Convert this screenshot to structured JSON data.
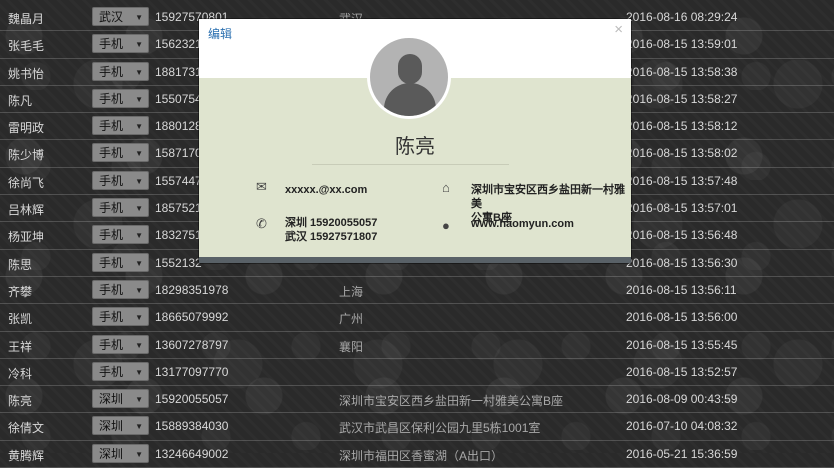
{
  "table": {
    "rows": [
      {
        "name": "魏晶月",
        "city": "武汉",
        "phone": "15927570801",
        "addr": "武汉",
        "time": "2016-08-16 08:29:24"
      },
      {
        "name": "张毛毛",
        "city": "手机",
        "phone": "1562321",
        "addr": "",
        "time": "2016-08-15 13:59:01"
      },
      {
        "name": "姚书怡",
        "city": "手机",
        "phone": "1881731",
        "addr": "",
        "time": "2016-08-15 13:58:38"
      },
      {
        "name": "陈凡",
        "city": "手机",
        "phone": "1550754",
        "addr": "",
        "time": "2016-08-15 13:58:27"
      },
      {
        "name": "雷明政",
        "city": "手机",
        "phone": "1880128",
        "addr": "",
        "time": "2016-08-15 13:58:12"
      },
      {
        "name": "陈少博",
        "city": "手机",
        "phone": "1587170",
        "addr": "",
        "time": "2016-08-15 13:58:02"
      },
      {
        "name": "徐尚飞",
        "city": "手机",
        "phone": "1557447",
        "addr": "",
        "time": "2016-08-15 13:57:48"
      },
      {
        "name": "吕林辉",
        "city": "手机",
        "phone": "1857521",
        "addr": "",
        "time": "2016-08-15 13:57:01"
      },
      {
        "name": "杨亚坤",
        "city": "手机",
        "phone": "1832751",
        "addr": "",
        "time": "2016-08-15 13:56:48"
      },
      {
        "name": "陈思",
        "city": "手机",
        "phone": "1552132",
        "addr": "",
        "time": "2016-08-15 13:56:30"
      },
      {
        "name": "齐攀",
        "city": "手机",
        "phone": "18298351978",
        "addr": "上海",
        "time": "2016-08-15 13:56:11"
      },
      {
        "name": "张凯",
        "city": "手机",
        "phone": "18665079992",
        "addr": "广州",
        "time": "2016-08-15 13:56:00"
      },
      {
        "name": "王祥",
        "city": "手机",
        "phone": "13607278797",
        "addr": "襄阳",
        "time": "2016-08-15 13:55:45"
      },
      {
        "name": "冷科",
        "city": "手机",
        "phone": "13177097770",
        "addr": "",
        "time": "2016-08-15 13:52:57"
      },
      {
        "name": "陈亮",
        "city": "深圳",
        "phone": "15920055057",
        "addr": "深圳市宝安区西乡盐田新一村雅美公寓B座",
        "time": "2016-08-09 00:43:59"
      },
      {
        "name": "徐倩文",
        "city": "深圳",
        "phone": "15889384030",
        "addr": "武汉市武昌区保利公园九里5栋1001室",
        "time": "2016-07-10 04:08:32"
      },
      {
        "name": "黄腾辉",
        "city": "深圳",
        "phone": "13246649002",
        "addr": "深圳市福田区香蜜湖（A出口）",
        "time": "2016-05-21 15:36:59"
      }
    ]
  },
  "modal": {
    "edit_label": "编辑",
    "close_label": "×",
    "name": "陈亮",
    "email": "xxxxx.@xx.com",
    "phone_line1": "深圳 15920055057",
    "phone_line2": "武汉 15927571807",
    "address_line1": "深圳市宝安区西乡盐田新一村雅美",
    "address_line2": "公寓B座",
    "website": "www.haomyun.com"
  }
}
